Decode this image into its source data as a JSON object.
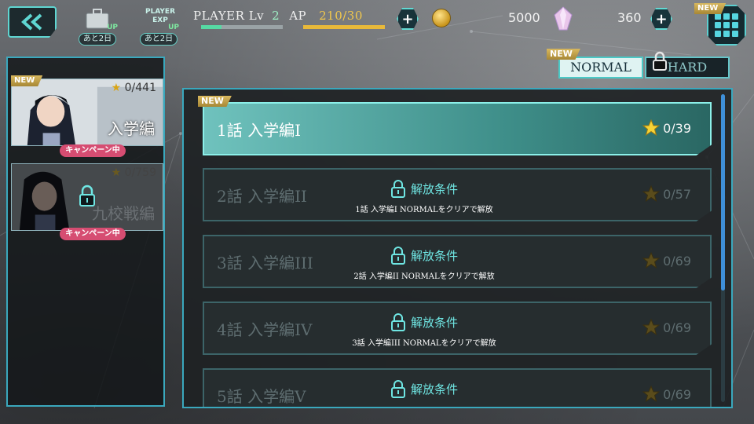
{
  "header": {
    "item_boost_label": "あと2日",
    "exp_boost_label": "あと2日",
    "exp_boost_text": "PLAYER EXP",
    "up_text": "UP",
    "player_label": "PLAYER Lv",
    "player_level": "2",
    "ap_label": "AP",
    "ap_value": "210/30",
    "money": "5000",
    "gems": "360",
    "exp_fraction": 0.25,
    "ap_fraction": 1.0,
    "new_badge": "NEW"
  },
  "tabs": {
    "normal_label": "NORMAL",
    "hard_label": "HARD",
    "new_badge": "NEW"
  },
  "arcs": [
    {
      "title": "入学編",
      "stars": "0/441",
      "campaign": "キャンペーン中",
      "badge": "NEW",
      "locked": false
    },
    {
      "title": "九校戦編",
      "stars": "0/759",
      "campaign": "キャンペーン中",
      "badge": "",
      "locked": true
    }
  ],
  "episodes": [
    {
      "title": "1話 入学編I",
      "stars": "0/39",
      "locked": false,
      "badge": "NEW"
    },
    {
      "title": "2話 入学編II",
      "stars": "0/57",
      "locked": true,
      "cond_title": "解放条件",
      "cond_text": "1話 入学編I NORMALをクリアで解放"
    },
    {
      "title": "3話 入学編III",
      "stars": "0/69",
      "locked": true,
      "cond_title": "解放条件",
      "cond_text": "2話 入学編II NORMALをクリアで解放"
    },
    {
      "title": "4話 入学編IV",
      "stars": "0/69",
      "locked": true,
      "cond_title": "解放条件",
      "cond_text": "3話 入学編III NORMALをクリアで解放"
    },
    {
      "title": "5話 入学編V",
      "stars": "0/69",
      "locked": true,
      "cond_title": "解放条件",
      "cond_text": ""
    }
  ],
  "colors": {
    "accent": "#5fd6d2",
    "gold": "#f1c84d",
    "campaign": "#d64d72"
  }
}
